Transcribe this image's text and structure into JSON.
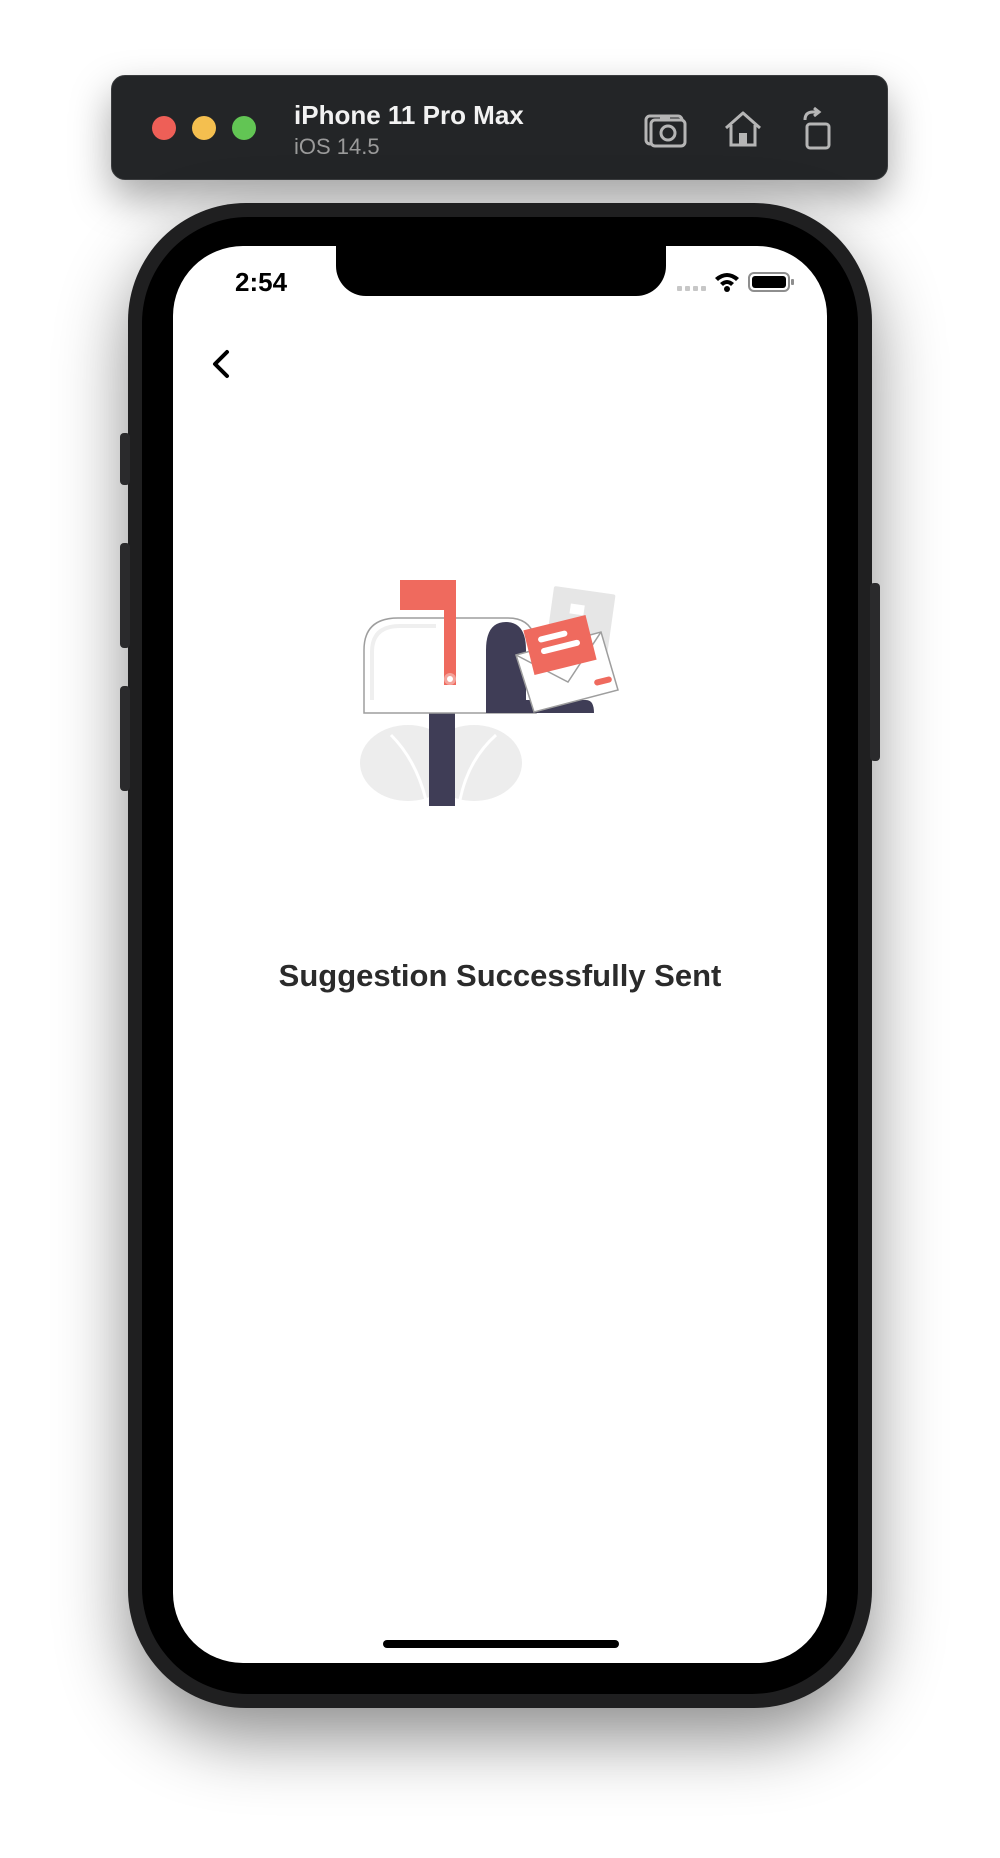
{
  "simulator": {
    "device_name": "iPhone 11 Pro Max",
    "os_version": "iOS 14.5",
    "traffic_light_colors": {
      "close": "#ee5f57",
      "minimize": "#f4bf4f",
      "zoom": "#62c554"
    },
    "toolbar_icons": [
      "screenshot-icon",
      "home-icon",
      "rotate-icon"
    ]
  },
  "status_bar": {
    "time": "2:54",
    "icons": [
      "signal-icon",
      "wifi-icon",
      "battery-icon"
    ]
  },
  "nav": {
    "back_icon": "chevron-left-icon"
  },
  "content": {
    "illustration": "mailbox-illustration",
    "message": "Suggestion Successfully Sent"
  },
  "colors": {
    "accent": "#ef6a5e",
    "dark_navy": "#3f3d56",
    "text": "#2b2b2b"
  }
}
